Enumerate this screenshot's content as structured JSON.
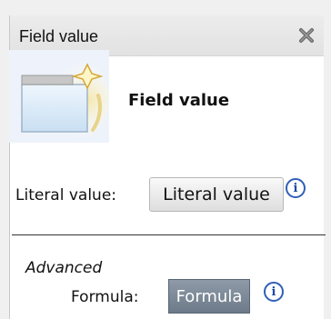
{
  "panel": {
    "title": "Field value",
    "close_icon": "close-x-icon"
  },
  "header": {
    "icon": "field-value-icon",
    "title": "Field value"
  },
  "literal": {
    "label": "Literal value:",
    "button_label": "Literal value",
    "info_icon": "info-icon",
    "info_glyph": "i"
  },
  "advanced": {
    "section_title": "Advanced",
    "formula_label": "Formula:",
    "formula_button_label": "Formula",
    "info_icon": "info-icon",
    "info_glyph": "i"
  },
  "colors": {
    "formula_button_bg": "#7d8998",
    "info_blue": "#1a4aa8"
  }
}
